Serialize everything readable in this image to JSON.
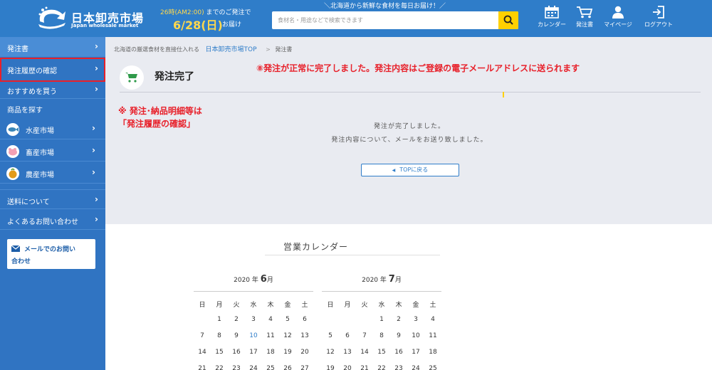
{
  "header": {
    "logo_text": "日本卸売市場",
    "logo_sub": "Japan wholesale market",
    "tagline": "＼北海道から新鮮な食材を毎日お届け！／",
    "cutoff_time": "26時(AM2:00)",
    "cutoff_suffix": "までのご発注で",
    "delivery_date": "6/28(日)",
    "delivery_suffix": "お届け",
    "search_placeholder": "食材名・用途などで検索できます",
    "nav": [
      {
        "label": "カレンダー",
        "icon": "calendar-icon"
      },
      {
        "label": "発注書",
        "icon": "cart-icon"
      },
      {
        "label": "マイページ",
        "icon": "user-icon"
      },
      {
        "label": "ログアウト",
        "icon": "logout-icon"
      }
    ]
  },
  "sidebar": {
    "items": [
      {
        "label": "発注書"
      },
      {
        "label": "発注履歴の確認"
      },
      {
        "label": "おすすめを買う"
      }
    ],
    "heading": "商品を探す",
    "categories": [
      {
        "label": "水産市場",
        "icon": "fish-icon"
      },
      {
        "label": "畜産市場",
        "icon": "pig-icon"
      },
      {
        "label": "農産市場",
        "icon": "vegetable-icon"
      }
    ],
    "bottom_items": [
      {
        "label": "送料について"
      },
      {
        "label": "よくあるお問い合わせ"
      }
    ],
    "mail_line1": "メールでのお問い",
    "mail_line2": "合わせ",
    "accent": "#3074c2",
    "highlight_color": "#e8202a"
  },
  "breadcrumb": {
    "prefix": "北海道の厳選食材を直接仕入れる",
    "link": "日本卸売市場TOP",
    "sep": ">",
    "current": "発注書"
  },
  "main": {
    "title": "発注完了",
    "annotation_main": "⑧発注が正常に完了しました。発注内容はご登録の電子メールアドレスに送られます",
    "annotation_side_1": "※ 発注･納品明細等は",
    "annotation_side_2": "「発注履歴の確認」",
    "message1": "発注が完了しました。",
    "message2": "発注内容について、メールをお送り致しました。",
    "top_button": "TOPに戻る"
  },
  "calendar": {
    "title": "営業カレンダー",
    "weekdays": [
      "日",
      "月",
      "火",
      "水",
      "木",
      "金",
      "土"
    ],
    "months": [
      {
        "year": "2020",
        "year_suffix": "年",
        "month": "6",
        "month_suffix": "月",
        "rows": [
          [
            "",
            "1",
            "2",
            "3",
            "4",
            "5",
            "6"
          ],
          [
            "7",
            "8",
            "9",
            "10",
            "11",
            "12",
            "13"
          ],
          [
            "14",
            "15",
            "16",
            "17",
            "18",
            "19",
            "20"
          ],
          [
            "21",
            "22",
            "23",
            "24",
            "25",
            "26",
            "27"
          ]
        ]
      },
      {
        "year": "2020",
        "year_suffix": "年",
        "month": "7",
        "month_suffix": "月",
        "rows": [
          [
            "",
            "",
            "",
            "1",
            "2",
            "3",
            "4"
          ],
          [
            "5",
            "6",
            "7",
            "8",
            "9",
            "10",
            "11"
          ],
          [
            "12",
            "13",
            "14",
            "15",
            "16",
            "17",
            "18"
          ],
          [
            "19",
            "20",
            "21",
            "22",
            "23",
            "24",
            "25"
          ]
        ]
      }
    ]
  }
}
